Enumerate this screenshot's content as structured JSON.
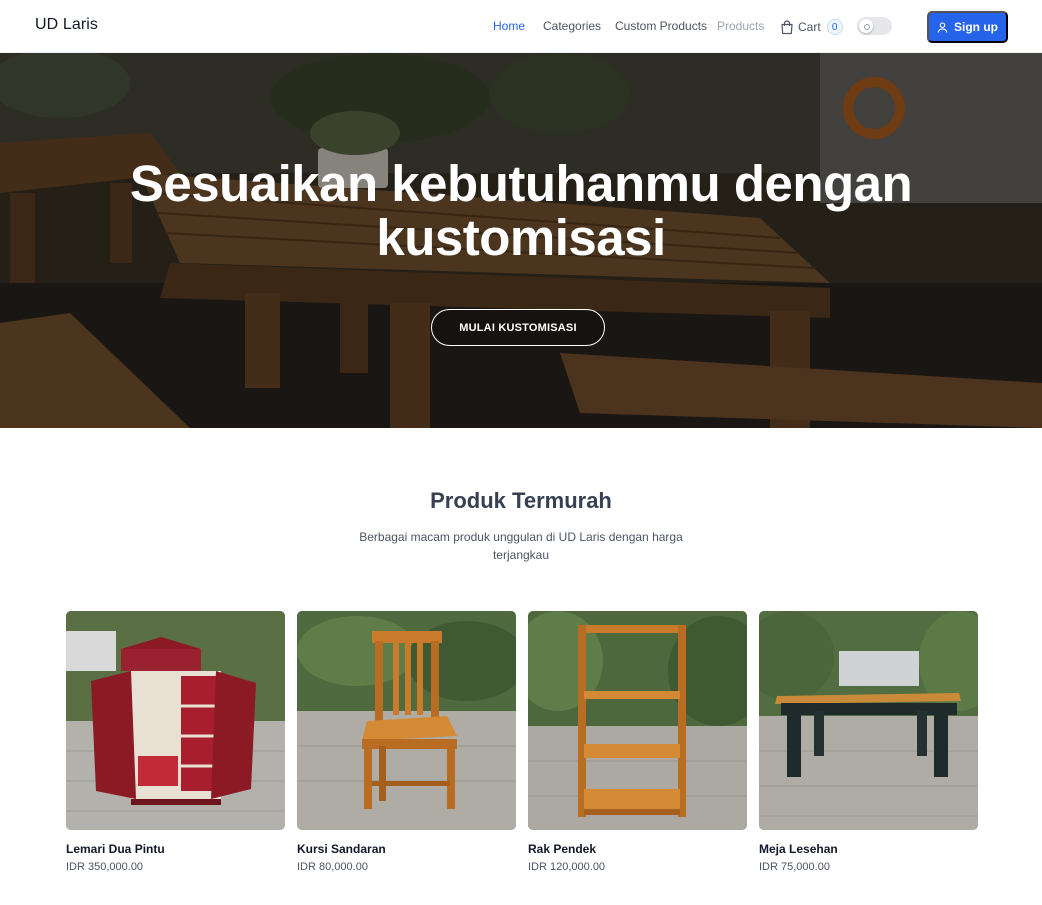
{
  "header": {
    "brand": "UD Laris",
    "nav": {
      "home": "Home",
      "categories": "Categories",
      "custom_products": "Custom Products",
      "products": "Products",
      "cart": "Cart",
      "cart_count": "0"
    },
    "signup": "Sign up",
    "icons": {
      "cart": "shopping-bag-icon",
      "user": "user-icon",
      "theme": "theme-toggle"
    }
  },
  "hero": {
    "title": "Sesuaikan kebutuhanmu dengan kustomisasi",
    "button": "MULAI KUSTOMISASI"
  },
  "section": {
    "title": "Produk Termurah",
    "subtitle": "Berbagai macam produk unggulan di UD Laris dengan harga terjangkau"
  },
  "products": [
    {
      "name": "Lemari Dua Pintu",
      "price": "IDR 350,000.00"
    },
    {
      "name": "Kursi Sandaran",
      "price": "IDR 80,000.00"
    },
    {
      "name": "Rak Pendek",
      "price": "IDR 120,000.00"
    },
    {
      "name": "Meja Lesehan",
      "price": "IDR 75,000.00"
    }
  ],
  "colors": {
    "accent": "#2563eb",
    "wood": "#c97a2b",
    "wardrobe": "#8b1a24",
    "table_top": "#c98b3a",
    "table_legs": "#1f2a2a"
  }
}
